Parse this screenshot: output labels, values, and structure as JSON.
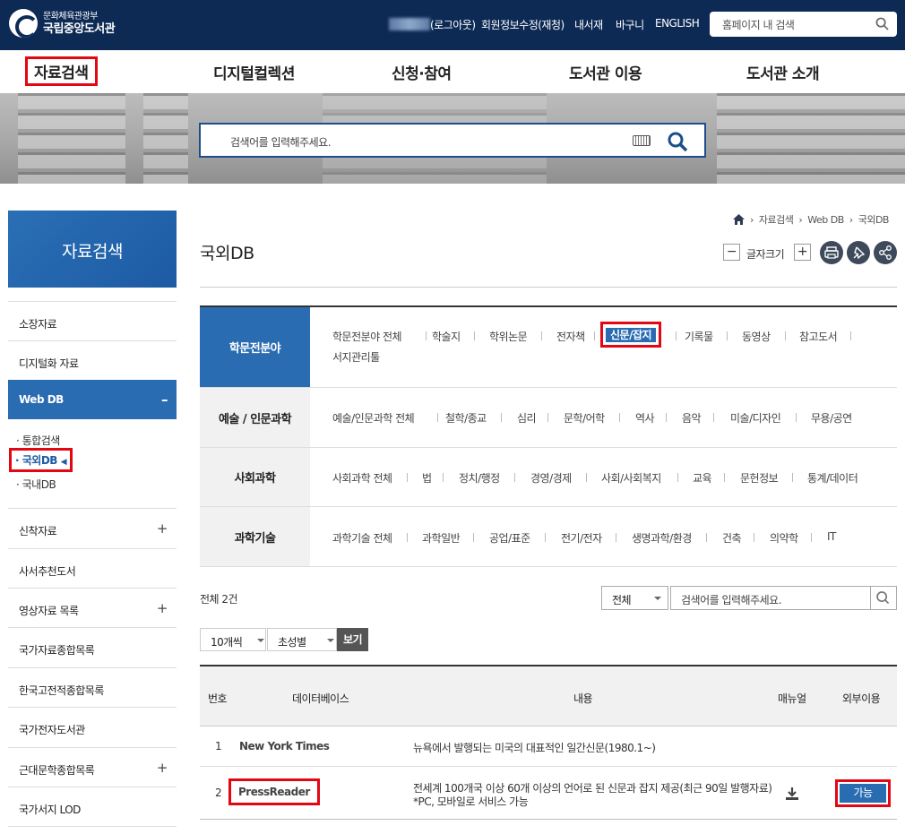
{
  "header": {
    "logo_sub": "문화체육관광부",
    "logo_main": "국립중앙도서관",
    "logout": "(로그아웃)",
    "links": [
      "회원정보수정(재청)",
      "내서재",
      "바구니",
      "ENGLISH"
    ],
    "search_placeholder": "홈페이지 내 검색"
  },
  "gnb": [
    "자료검색",
    "디지털컬렉션",
    "신청·참여",
    "도서관 이용",
    "도서관 소개"
  ],
  "banner": {
    "search_placeholder": "검색어를 입력해주세요."
  },
  "sidebar": {
    "title": "자료검색",
    "items": [
      {
        "label": "소장자료",
        "expandable": false
      },
      {
        "label": "디지털화 자료",
        "expandable": false
      },
      {
        "label": "Web DB",
        "expandable": true,
        "expanded": true
      },
      {
        "label": "신착자료",
        "expandable": true
      },
      {
        "label": "사서추천도서",
        "expandable": false
      },
      {
        "label": "영상자료 목록",
        "expandable": true
      },
      {
        "label": "국가자료종합목록",
        "expandable": false
      },
      {
        "label": "한국고전적종합목록",
        "expandable": false
      },
      {
        "label": "국가전자도서관",
        "expandable": false
      },
      {
        "label": "근대문학종합목록",
        "expandable": true
      },
      {
        "label": "국가서지 LOD",
        "expandable": false
      }
    ],
    "webdb_sub": [
      "통합검색",
      "국외DB",
      "국내DB"
    ],
    "plus": "+",
    "minus": "–"
  },
  "breadcrumb": [
    "자료검색",
    "Web DB",
    "국외DB"
  ],
  "page_title": "국외DB",
  "font_size": {
    "label": "글자크기",
    "minus": "−",
    "plus": "+"
  },
  "categories": [
    {
      "head": "학문전분야",
      "links": [
        "학문전분야 전체",
        "학술지",
        "학위논문",
        "전자책",
        "신문/잡지",
        "기록물",
        "동영상",
        "참고도서",
        "서지관리툴"
      ],
      "selected": "신문/잡지"
    },
    {
      "head": "예술 / 인문과학",
      "links": [
        "예술/인문과학 전체",
        "철학/종교",
        "심리",
        "문학/어학",
        "역사",
        "음악",
        "미술/디자인",
        "무용/공연"
      ]
    },
    {
      "head": "사회과학",
      "links": [
        "사회과학 전체",
        "법",
        "정치/행정",
        "경영/경제",
        "사회/사회복지",
        "교육",
        "문헌정보",
        "통계/데이터"
      ]
    },
    {
      "head": "과학기술",
      "links": [
        "과학기술 전체",
        "과학일반",
        "공업/표준",
        "전기/전자",
        "생명과학/환경",
        "건축",
        "의약학",
        "IT"
      ]
    }
  ],
  "results": {
    "total": "전체 2건",
    "filter": "전체",
    "search_placeholder": "검색어를 입력해주세요.",
    "per_page": "10개씩",
    "sort": "초성별",
    "view": "보기",
    "columns": [
      "번호",
      "데이터베이스",
      "내용",
      "매뉴얼",
      "외부이용"
    ],
    "rows": [
      {
        "no": "1",
        "db": "New York Times",
        "desc": [
          "뉴욕에서 발행되는 미국의 대표적인 일간신문(1980.1~)"
        ],
        "manual": false,
        "external": ""
      },
      {
        "no": "2",
        "db": "PressReader",
        "desc": [
          "전세계 100개국 이상 60개 이상의 언어로 된 신문과 잡지 제공(최근 90일 발행자료)",
          "*PC, 모바일로 서비스 가능"
        ],
        "manual": true,
        "external": "가능"
      }
    ]
  },
  "colors": {
    "top_bar": "#0d2a55",
    "accent": "#2a6cb2",
    "highlight": "#e30613"
  }
}
